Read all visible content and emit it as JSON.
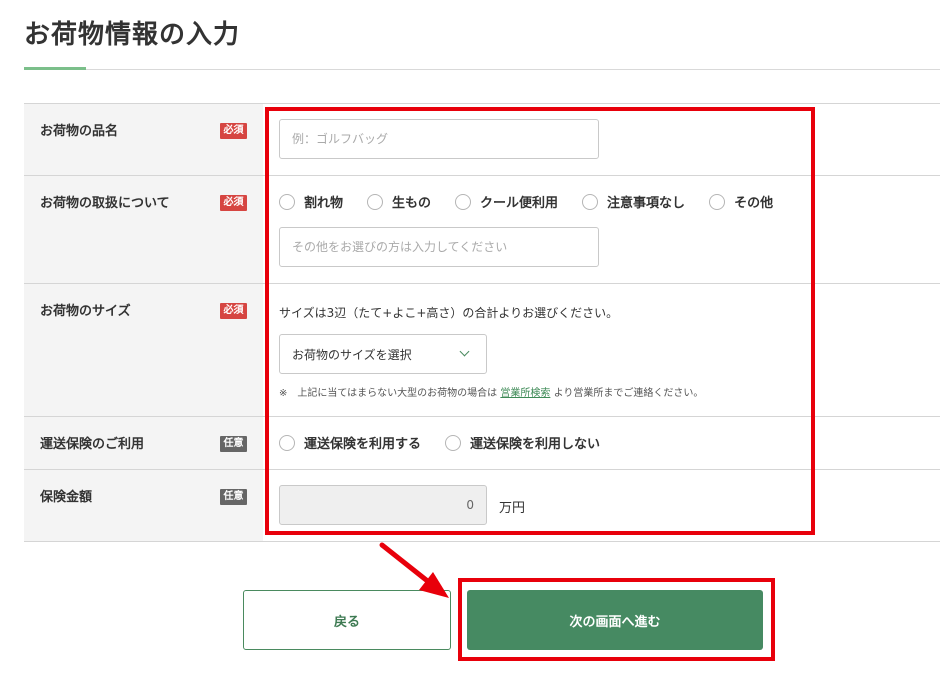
{
  "page": {
    "title": "お荷物情報の入力"
  },
  "form": {
    "item_name": {
      "label": "お荷物の品名",
      "badge": "必須",
      "placeholder": "例：ゴルフバッグ"
    },
    "handling": {
      "label": "お荷物の取扱について",
      "badge": "必須",
      "options": [
        "割れ物",
        "生もの",
        "クール便利用",
        "注意事項なし",
        "その他"
      ],
      "other_placeholder": "その他をお選びの方は入力してください"
    },
    "size": {
      "label": "お荷物のサイズ",
      "badge": "必須",
      "helper": "サイズは3辺（たて+よこ+高さ）の合計よりお選びください。",
      "select_value": "お荷物のサイズを選択",
      "note_prefix": "※　上記に当てはまらない大型のお荷物の場合は",
      "note_link": "営業所検索",
      "note_suffix": "より営業所までご連絡ください。"
    },
    "insurance": {
      "label": "運送保険のご利用",
      "badge": "任意",
      "options": [
        "運送保険を利用する",
        "運送保険を利用しない"
      ]
    },
    "amount": {
      "label": "保険金額",
      "badge": "任意",
      "value": "0",
      "unit": "万円"
    }
  },
  "buttons": {
    "back": "戻る",
    "next": "次の画面へ進む"
  },
  "colors": {
    "accent_green": "#468a62",
    "required_badge": "#d64541",
    "optional_badge": "#666666",
    "highlight_red": "#e8000b"
  }
}
